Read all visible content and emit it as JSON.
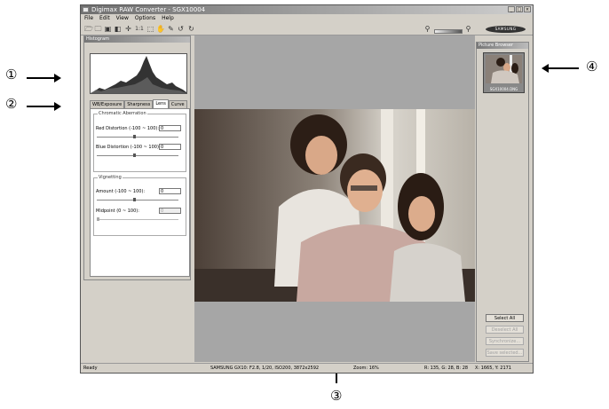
{
  "callouts": {
    "one": "①",
    "two": "②",
    "three": "③",
    "four": "④"
  },
  "window": {
    "title": "Digimax RAW Converter - SGX10004",
    "min": "_",
    "max": "□",
    "close": "×"
  },
  "menu": [
    "File",
    "Edit",
    "View",
    "Options",
    "Help"
  ],
  "toolbar": {
    "icons": [
      "open-icon",
      "open-folder-icon",
      "save-icon",
      "compare-icon",
      "fit-icon",
      "actual-size-icon",
      "zoom-box-icon",
      "hand-icon",
      "eyedropper-icon",
      "rotate-left-icon",
      "rotate-right-icon"
    ],
    "one_to_one": "1:1",
    "brand": "SAMSUNG"
  },
  "left_panel": {
    "header": "Histogram",
    "tabs": [
      "WB/Exposure",
      "Sharpness",
      "Lens",
      "Curve"
    ],
    "active_tab": "Lens",
    "chromatic": {
      "title": "Chromatic Aberration",
      "red_label": "Red Distortion (-100 ~ 100):",
      "red_value": "0",
      "blue_label": "Blue Distortion (-100 ~ 100):",
      "blue_value": "0"
    },
    "vignetting": {
      "title": "Vignetting",
      "amount_label": "Amount (-100 ~ 100):",
      "amount_value": "0",
      "midpoint_label": "Midpoint (0 ~ 100):",
      "midpoint_value": "0"
    }
  },
  "right_panel": {
    "header": "Picture Browser",
    "thumb_caption": "SGX10004.DNG",
    "buttons": {
      "select_all": "Select All",
      "deselect_all": "Deselect All",
      "synchronize": "Synchronize...",
      "save_selected": "Save selected..."
    }
  },
  "status": {
    "ready": "Ready",
    "camera": "SAMSUNG GX10: F2.8, 1/20, ISO200, 3872x2592",
    "zoom": "Zoom: 16%",
    "rgb": "R: 135, G: 28, B: 28",
    "coords": "X: 1665, Y: 2171"
  }
}
